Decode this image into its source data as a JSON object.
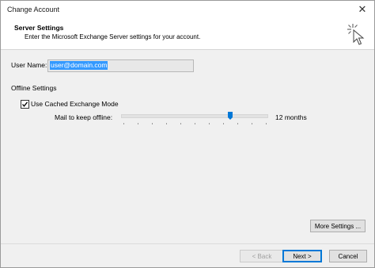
{
  "window": {
    "title": "Change Account"
  },
  "header": {
    "title": "Server Settings",
    "subtitle": "Enter the Microsoft Exchange Server settings for your account."
  },
  "form": {
    "username_label": "User Name:",
    "username_value": "user@domain.com",
    "offline_section": "Offline Settings",
    "cached_mode_label": "Use Cached Exchange Mode",
    "cached_mode_checked": true,
    "mail_offline_label": "Mail to keep offline:",
    "mail_offline_value": "12 months",
    "slider_position_fraction": 0.74
  },
  "buttons": {
    "more_settings": "More Settings ...",
    "back": "< Back",
    "next": "Next >",
    "cancel": "Cancel"
  },
  "colors": {
    "selection": "#3399ff",
    "accent": "#0078d7",
    "slider_thumb": "#0078d7"
  },
  "icons": {
    "close": "close-icon",
    "cursor": "cursor-click-icon",
    "checkmark": "checkmark-icon"
  }
}
